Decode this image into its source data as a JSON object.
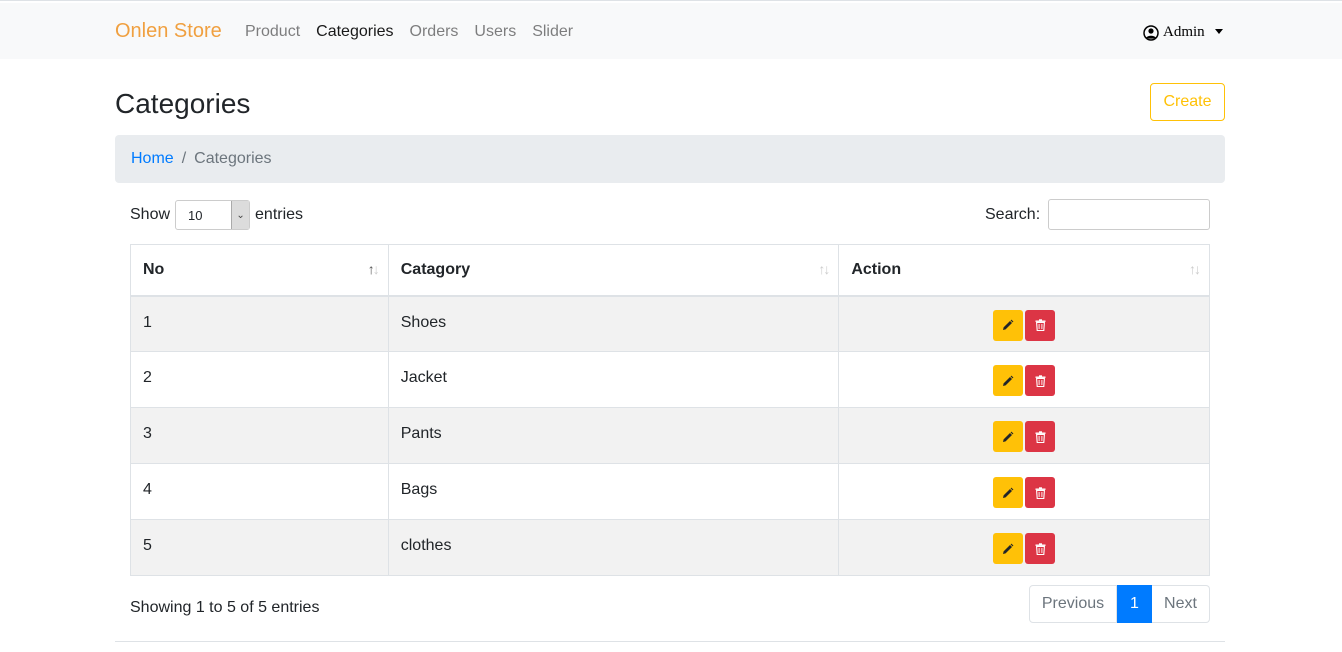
{
  "nav": {
    "brand": "Onlen Store",
    "links": [
      "Product",
      "Categories",
      "Orders",
      "Users",
      "Slider"
    ],
    "active_link": "Categories",
    "user": "Admin"
  },
  "page": {
    "title": "Categories",
    "create_label": "Create"
  },
  "breadcrumb": {
    "home": "Home",
    "separator": "/",
    "current": "Categories"
  },
  "table_controls": {
    "show_label": "Show",
    "entries_label": "entries",
    "page_length": "10",
    "search_label": "Search:",
    "search_value": ""
  },
  "table": {
    "headers": [
      "No",
      "Catagory",
      "Action"
    ],
    "rows": [
      {
        "no": "1",
        "category": "Shoes"
      },
      {
        "no": "2",
        "category": "Jacket"
      },
      {
        "no": "3",
        "category": "Pants"
      },
      {
        "no": "4",
        "category": "Bags"
      },
      {
        "no": "5",
        "category": "clothes"
      }
    ]
  },
  "footer": {
    "info": "Showing 1 to 5 of 5 entries",
    "prev": "Previous",
    "page": "1",
    "next": "Next"
  },
  "colors": {
    "brand": "#f0a040",
    "warning": "#ffc107",
    "danger": "#dc3545",
    "primary": "#007bff"
  },
  "icons": {
    "user": "user-circle-icon",
    "edit": "pencil-icon",
    "delete": "trash-icon"
  }
}
